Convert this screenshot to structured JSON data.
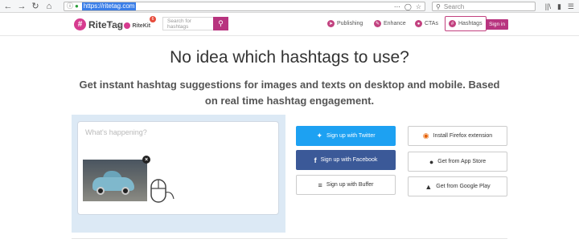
{
  "browser": {
    "back_icon": "arrow-left-icon",
    "forward_icon": "arrow-right-icon",
    "reload_icon": "reload-icon",
    "home_icon": "home-icon",
    "url": "https://ritetag.com",
    "search_placeholder": "Search"
  },
  "header": {
    "logo_text": "RiteTag",
    "by_text": "by",
    "ritekit_text": "RiteKit",
    "badge_count": "6",
    "search_placeholder": "Search for hashtags",
    "nav": [
      {
        "label": "Publishing"
      },
      {
        "label": "Enhance"
      },
      {
        "label": "CTAs"
      },
      {
        "label": "Hashtags"
      }
    ],
    "signin_label": "Sign in"
  },
  "hero": {
    "headline": "No idea which hashtags to use?",
    "subline": "Get instant hashtag suggestions for images and texts on desktop and mobile. Based on real time hashtag engagement."
  },
  "demo": {
    "compose_placeholder": "What's happening?"
  },
  "buttons": {
    "twitter": "Sign up with Twitter",
    "facebook": "Sign up with Facebook",
    "buffer": "Sign up with Buffer",
    "firefox": "Install Firefox extension",
    "appstore": "Get from App Store",
    "play": "Get from Google Play"
  },
  "colors": {
    "brand": "#b8347f",
    "twitter": "#1da1f2",
    "facebook": "#3b5998",
    "demo_panel": "#dce9f5"
  }
}
